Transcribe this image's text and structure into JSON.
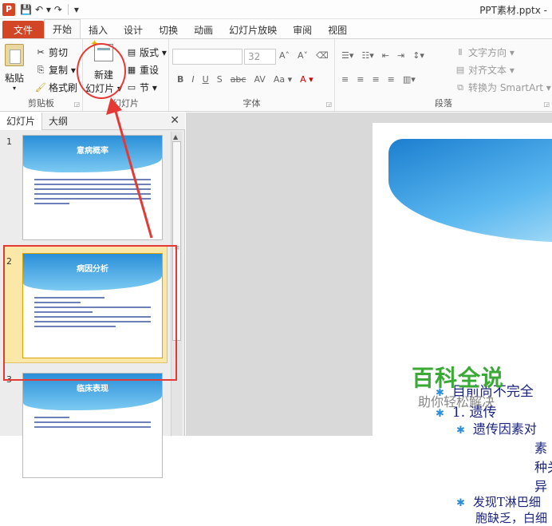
{
  "titlebar": {
    "app_letter": "P",
    "window_title": "PPT素材.pptx -"
  },
  "tabs": [
    "文件",
    "开始",
    "插入",
    "设计",
    "切换",
    "动画",
    "幻灯片放映",
    "审阅",
    "视图"
  ],
  "ribbon": {
    "clipboard": {
      "paste": "粘贴",
      "cut": "剪切",
      "copy": "复制 ▾",
      "format_painter": "格式刷",
      "label": "剪贴板"
    },
    "slides": {
      "new_slide_line1": "新建",
      "new_slide_line2": "幻灯片 ▾",
      "layout": "版式 ▾",
      "reset": "重设",
      "section": "节 ▾",
      "label": "幻灯片"
    },
    "font": {
      "size": "32",
      "grow": "A˄",
      "shrink": "A˅",
      "bold": "B",
      "italic": "I",
      "underline": "U",
      "strike": "S",
      "abc": "abc",
      "spacing": "AV",
      "case": "Aa ▾",
      "color": "A ▾",
      "label": "字体"
    },
    "paragraph": {
      "text_direction": "文字方向 ▾",
      "align_text": "对齐文本 ▾",
      "smartart": "转换为 SmartArt ▾",
      "label": "段落"
    }
  },
  "pane": {
    "tab_slides": "幻灯片",
    "tab_outline": "大纲",
    "close": "✕",
    "thumbs": [
      {
        "num": "1",
        "title": "意病概率"
      },
      {
        "num": "2",
        "title": "病因分析"
      },
      {
        "num": "3",
        "title": "临床表现"
      }
    ]
  },
  "slide": {
    "bullets": [
      "目前尚不完全",
      "1. 遗传",
      "遗传因素对",
      "素",
      "种关",
      "异",
      "发现T淋巴细",
      "胞缺乏，白细"
    ]
  },
  "watermark": {
    "title": "百科全说",
    "subtitle": "助你轻松解决"
  },
  "colors": {
    "file_tab": "#d24625",
    "accent_blue": "#2a8fd8",
    "annotation_red": "#e53935",
    "watermark_green": "#3aa935"
  }
}
